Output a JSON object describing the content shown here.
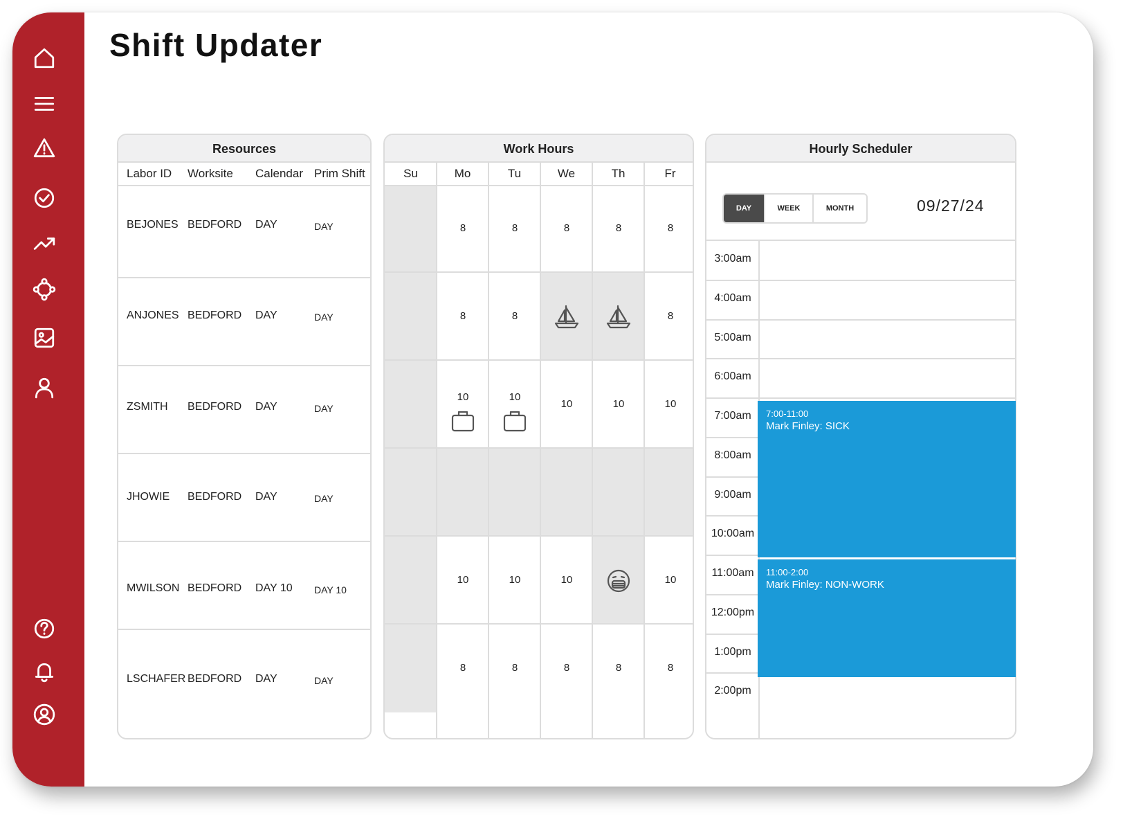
{
  "app": {
    "title": "Shift Updater"
  },
  "sidebar": {
    "top_items": [
      {
        "icon": "home-icon"
      },
      {
        "icon": "menu-icon"
      },
      {
        "icon": "alert-triangle-icon"
      },
      {
        "icon": "check-circle-icon"
      },
      {
        "icon": "trending-up-icon"
      },
      {
        "icon": "network-nodes-icon"
      },
      {
        "icon": "image-icon"
      },
      {
        "icon": "user-icon"
      }
    ],
    "bottom_items": [
      {
        "icon": "help-circle-icon"
      },
      {
        "icon": "bell-icon"
      },
      {
        "icon": "account-circle-icon"
      }
    ],
    "color": "#b0222a"
  },
  "resources": {
    "title": "Resources",
    "columns": [
      "Labor ID",
      "Worksite",
      "Calendar",
      "Prim Shift"
    ],
    "rows": [
      {
        "labor_id": "BEJONES",
        "worksite": "BEDFORD",
        "calendar": "DAY",
        "prim_shift": "DAY"
      },
      {
        "labor_id": "ANJONES",
        "worksite": "BEDFORD",
        "calendar": "DAY",
        "prim_shift": "DAY"
      },
      {
        "labor_id": "ZSMITH",
        "worksite": "BEDFORD",
        "calendar": "DAY",
        "prim_shift": "DAY"
      },
      {
        "labor_id": "JHOWIE",
        "worksite": "BEDFORD",
        "calendar": "DAY",
        "prim_shift": "DAY"
      },
      {
        "labor_id": "MWILSON",
        "worksite": "BEDFORD",
        "calendar": "DAY 10",
        "prim_shift": "DAY 10"
      },
      {
        "labor_id": "LSCHAFER",
        "worksite": "BEDFORD",
        "calendar": "DAY",
        "prim_shift": "DAY"
      }
    ]
  },
  "work_hours": {
    "title": "Work Hours",
    "days": [
      "Su",
      "Mo",
      "Tu",
      "We",
      "Th",
      "Fr"
    ],
    "rows": [
      {
        "cells": [
          {
            "v": "",
            "shade": true
          },
          {
            "v": "8"
          },
          {
            "v": "8"
          },
          {
            "v": "8"
          },
          {
            "v": "8"
          },
          {
            "v": "8"
          }
        ]
      },
      {
        "cells": [
          {
            "v": "",
            "shade": true
          },
          {
            "v": "8"
          },
          {
            "v": "8"
          },
          {
            "v": "",
            "shade": true,
            "icon": "sailboat-icon"
          },
          {
            "v": "",
            "shade": true,
            "icon": "sailboat-icon"
          },
          {
            "v": "8"
          }
        ]
      },
      {
        "cells": [
          {
            "v": "",
            "shade": true
          },
          {
            "v": "10",
            "icon": "briefcase-icon"
          },
          {
            "v": "10",
            "icon": "briefcase-icon"
          },
          {
            "v": "10"
          },
          {
            "v": "10"
          },
          {
            "v": "10"
          }
        ]
      },
      {
        "cells": [
          {
            "v": "",
            "shade": true
          },
          {
            "v": "",
            "shade": true
          },
          {
            "v": "",
            "shade": true
          },
          {
            "v": "",
            "shade": true
          },
          {
            "v": "",
            "shade": true
          },
          {
            "v": "",
            "shade": true
          }
        ]
      },
      {
        "cells": [
          {
            "v": "",
            "shade": true
          },
          {
            "v": "10"
          },
          {
            "v": "10"
          },
          {
            "v": "10"
          },
          {
            "v": "",
            "shade": true,
            "icon": "sick-face-icon"
          },
          {
            "v": "10"
          }
        ]
      },
      {
        "cells": [
          {
            "v": "",
            "shade": true
          },
          {
            "v": "8"
          },
          {
            "v": "8"
          },
          {
            "v": "8"
          },
          {
            "v": "8"
          },
          {
            "v": "8"
          }
        ]
      }
    ]
  },
  "scheduler": {
    "title": "Hourly Scheduler",
    "views": [
      "DAY",
      "WEEK",
      "MONTH"
    ],
    "active_view": "DAY",
    "date": "09/27/24",
    "times": [
      "3:00am",
      "4:00am",
      "5:00am",
      "6:00am",
      "7:00am",
      "8:00am",
      "9:00am",
      "10:00am",
      "11:00am",
      "12:00pm",
      "1:00pm",
      "2:00pm"
    ],
    "events": [
      {
        "time": "7:00-11:00",
        "label": "Mark Finley: SICK"
      },
      {
        "time": "11:00-2:00",
        "label": "Mark Finley: NON-WORK"
      }
    ],
    "event_color": "#1b9ad8"
  }
}
